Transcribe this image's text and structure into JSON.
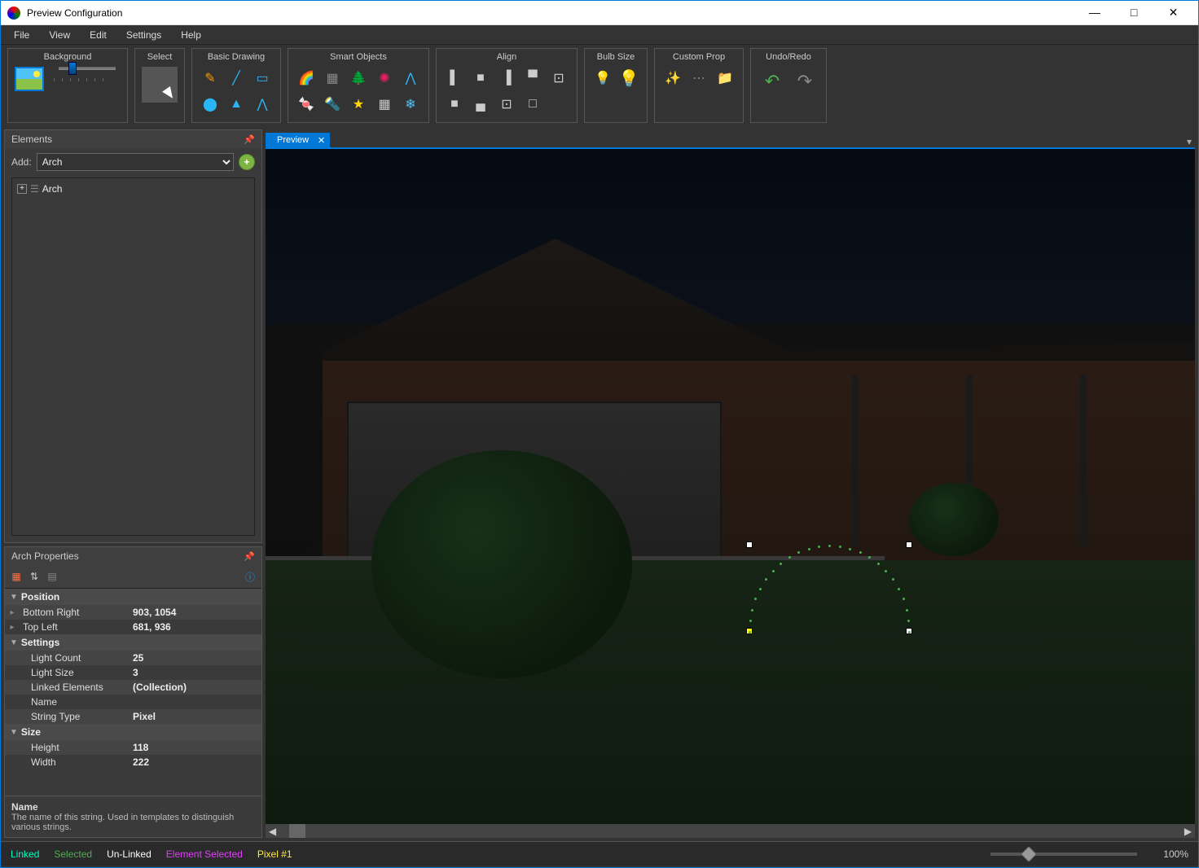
{
  "window": {
    "title": "Preview Configuration"
  },
  "menu": [
    "File",
    "View",
    "Edit",
    "Settings",
    "Help"
  ],
  "ribbon": {
    "background": "Background",
    "select": "Select",
    "drawing": "Basic Drawing",
    "smart": "Smart Objects",
    "align": "Align",
    "bulb": "Bulb Size",
    "custom": "Custom Prop",
    "undo": "Undo/Redo"
  },
  "elements": {
    "header": "Elements",
    "add_label": "Add:",
    "add_value": "Arch",
    "tree": [
      {
        "label": "Arch"
      }
    ]
  },
  "props": {
    "header": "Arch Properties",
    "categories": [
      {
        "name": "Position",
        "rows": [
          {
            "k": "Bottom Right",
            "v": "903, 1054",
            "exp": true
          },
          {
            "k": "Top Left",
            "v": "681, 936",
            "exp": true
          }
        ]
      },
      {
        "name": "Settings",
        "rows": [
          {
            "k": "Light Count",
            "v": "25"
          },
          {
            "k": "Light Size",
            "v": "3"
          },
          {
            "k": "Linked Elements",
            "v": "(Collection)"
          },
          {
            "k": "Name",
            "v": ""
          },
          {
            "k": "String Type",
            "v": "Pixel"
          }
        ]
      },
      {
        "name": "Size",
        "rows": [
          {
            "k": "Height",
            "v": "118"
          },
          {
            "k": "Width",
            "v": "222"
          }
        ]
      }
    ],
    "desc": {
      "title": "Name",
      "body": "The name of this string. Used in templates to distinguish various strings."
    }
  },
  "preview": {
    "tab": "Preview"
  },
  "status": {
    "linked": "Linked",
    "selected": "Selected",
    "unlinked": "Un-Linked",
    "element_selected": "Element Selected",
    "pixel": "Pixel #1",
    "zoom": "100%"
  },
  "colors": {
    "accent": "#0078d7",
    "linked": "#00ffc3",
    "selected": "#4caf50",
    "unlinked": "#ffffff",
    "element_selected": "#e040fb",
    "pixel": "#ffeb3b"
  }
}
